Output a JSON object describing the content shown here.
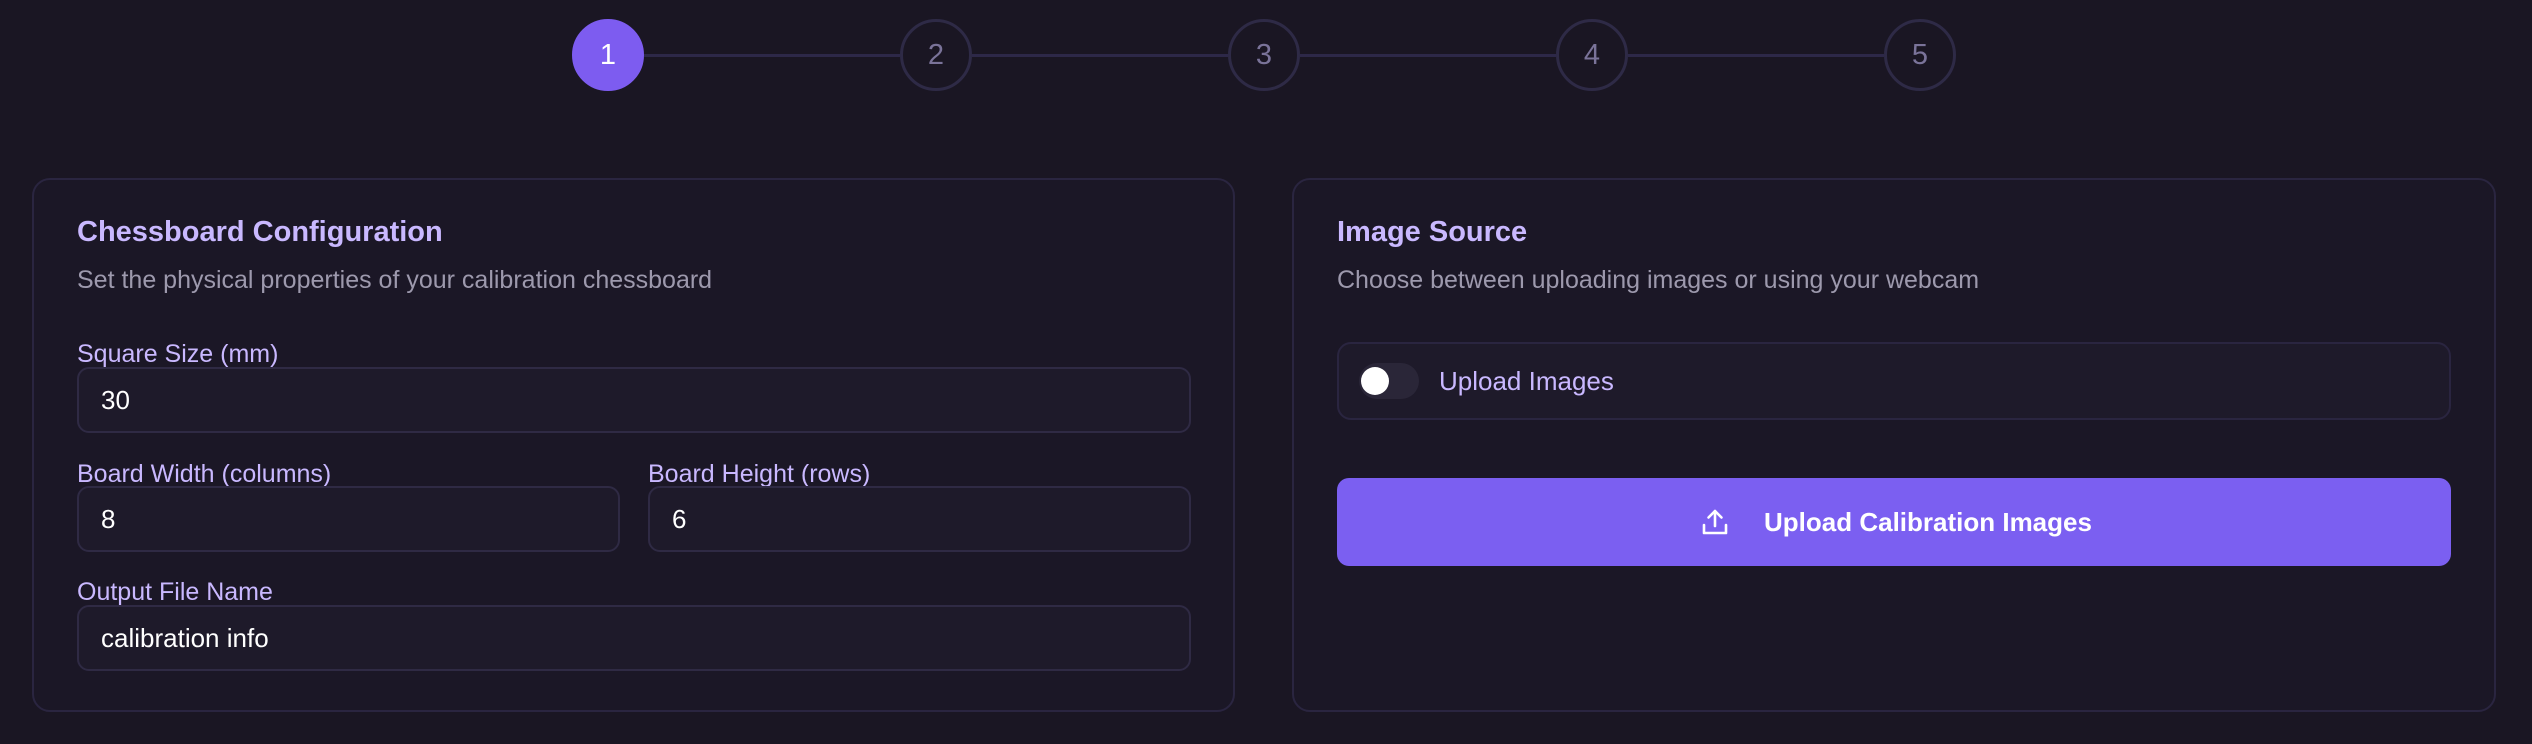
{
  "stepper": {
    "steps": [
      "1",
      "2",
      "3",
      "4",
      "5"
    ],
    "active_step": "1"
  },
  "chessboard": {
    "title": "Chessboard Configuration",
    "subtitle": "Set the physical properties of your calibration chessboard",
    "square_size": {
      "label": "Square Size (mm)",
      "value": "30"
    },
    "board_width": {
      "label": "Board Width (columns)",
      "value": "8"
    },
    "board_height": {
      "label": "Board Height (rows)",
      "value": "6"
    },
    "output_file": {
      "label": "Output File Name",
      "value": "calibration info"
    }
  },
  "image_source": {
    "title": "Image Source",
    "subtitle": "Choose between uploading images or using your webcam",
    "toggle": {
      "label": "Upload Images",
      "checked": false
    },
    "upload_button": {
      "label": "Upload Calibration Images",
      "icon": "upload-icon"
    }
  },
  "colors": {
    "background": "#1a1623",
    "card_background": "#1b1726",
    "accent": "#7b5ff1",
    "active_step": "#7d5cf0",
    "heading": "#c9b8ff",
    "muted_text": "#9d99ad"
  }
}
